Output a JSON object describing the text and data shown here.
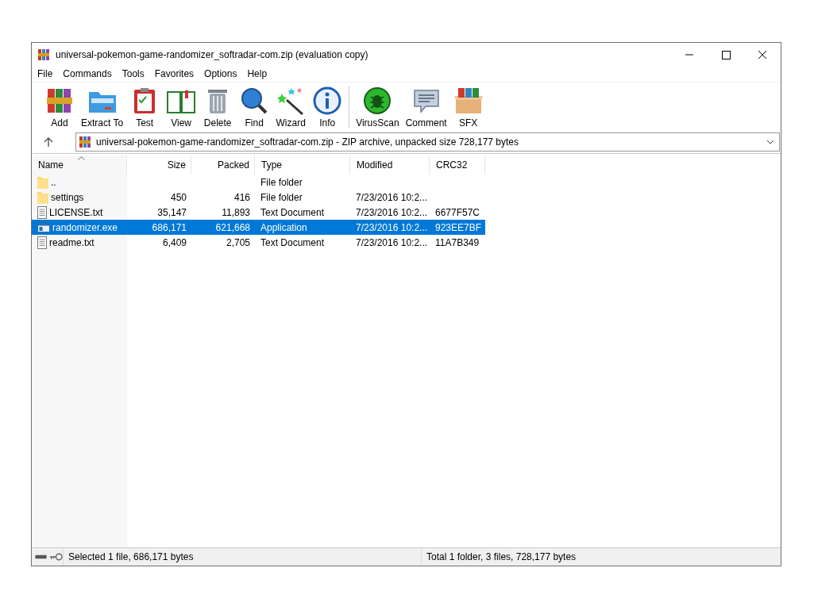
{
  "window": {
    "title": "universal-pokemon-game-randomizer_softradar-com.zip (evaluation copy)"
  },
  "menu": [
    "File",
    "Commands",
    "Tools",
    "Favorites",
    "Options",
    "Help"
  ],
  "toolbar": [
    {
      "label": "Add"
    },
    {
      "label": "Extract To"
    },
    {
      "label": "Test"
    },
    {
      "label": "View"
    },
    {
      "label": "Delete"
    },
    {
      "label": "Find"
    },
    {
      "label": "Wizard"
    },
    {
      "label": "Info"
    },
    {
      "label": "VirusScan",
      "group_start": true
    },
    {
      "label": "Comment"
    },
    {
      "label": "SFX"
    }
  ],
  "address": {
    "value": "universal-pokemon-game-randomizer_softradar-com.zip - ZIP archive, unpacked size 728,177 bytes"
  },
  "table": {
    "columns": [
      "Name",
      "Size",
      "Packed",
      "Type",
      "Modified",
      "CRC32"
    ],
    "rows": [
      {
        "kind": "folder",
        "selected": false,
        "cells": [
          "..",
          "",
          "",
          "File folder",
          "",
          ""
        ]
      },
      {
        "kind": "folder",
        "selected": false,
        "cells": [
          "settings",
          "450",
          "416",
          "File folder",
          "7/23/2016 10:2...",
          ""
        ]
      },
      {
        "kind": "text",
        "selected": false,
        "cells": [
          "LICENSE.txt",
          "35,147",
          "11,893",
          "Text Document",
          "7/23/2016 10:2...",
          "6677F57C"
        ]
      },
      {
        "kind": "app",
        "selected": true,
        "cells": [
          "randomizer.exe",
          "686,171",
          "621,668",
          "Application",
          "7/23/2016 10:2...",
          "923EE7BF"
        ]
      },
      {
        "kind": "text",
        "selected": false,
        "cells": [
          "readme.txt",
          "6,409",
          "2,705",
          "Text Document",
          "7/23/2016 10:2...",
          "11A7B349"
        ]
      }
    ]
  },
  "status_bar": {
    "left": "Selected 1 file, 686,171 bytes",
    "right": "Total 1 folder, 3 files, 728,177 bytes"
  }
}
